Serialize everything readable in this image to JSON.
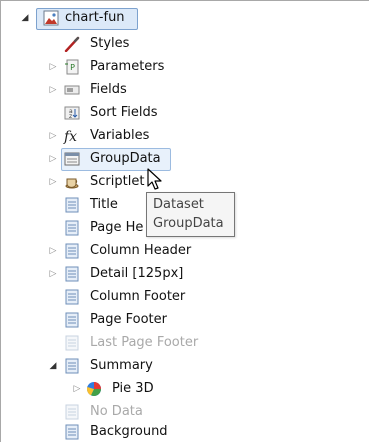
{
  "tree": {
    "root": {
      "label": "chart-fun",
      "icon": "report-icon",
      "expanded": true,
      "selected": true
    },
    "items": [
      {
        "label": "Styles",
        "icon": "brush-icon",
        "expander": "none"
      },
      {
        "label": "Parameters",
        "icon": "parameter-icon",
        "expander": "collapsed"
      },
      {
        "label": "Fields",
        "icon": "field-icon",
        "expander": "collapsed"
      },
      {
        "label": "Sort Fields",
        "icon": "sort-icon",
        "expander": "none"
      },
      {
        "label": "Variables",
        "icon": "fx-icon",
        "expander": "collapsed"
      },
      {
        "label": "GroupData",
        "icon": "group-icon",
        "expander": "collapsed",
        "hovered": true
      },
      {
        "label": "Scriptlet",
        "icon": "coffee-cup-icon",
        "expander": "collapsed"
      },
      {
        "label": "Title",
        "icon": "band-icon",
        "expander": "none"
      },
      {
        "label": "Page He",
        "icon": "band-icon",
        "expander": "none"
      },
      {
        "label": "Column Header",
        "icon": "band-icon",
        "expander": "collapsed"
      },
      {
        "label": "Detail [125px]",
        "icon": "band-icon",
        "expander": "collapsed"
      },
      {
        "label": "Column Footer",
        "icon": "band-icon",
        "expander": "none"
      },
      {
        "label": "Page Footer",
        "icon": "band-icon",
        "expander": "none"
      },
      {
        "label": "Last Page Footer",
        "icon": "band-icon",
        "expander": "none",
        "disabled": true
      },
      {
        "label": "Summary",
        "icon": "band-icon",
        "expander": "expanded"
      },
      {
        "label": "Pie 3D",
        "icon": "pie-chart-icon",
        "expander": "collapsed",
        "nested": true
      },
      {
        "label": "No Data",
        "icon": "band-icon",
        "expander": "none",
        "disabled": true
      },
      {
        "label": "Background",
        "icon": "band-icon",
        "expander": "none"
      }
    ]
  },
  "tooltip": {
    "line1": "Dataset",
    "line2": "GroupData"
  },
  "colors": {
    "selection": "#dce9f8",
    "selection_border": "#7da2ce",
    "disabled_text": "#a9a9a9"
  }
}
